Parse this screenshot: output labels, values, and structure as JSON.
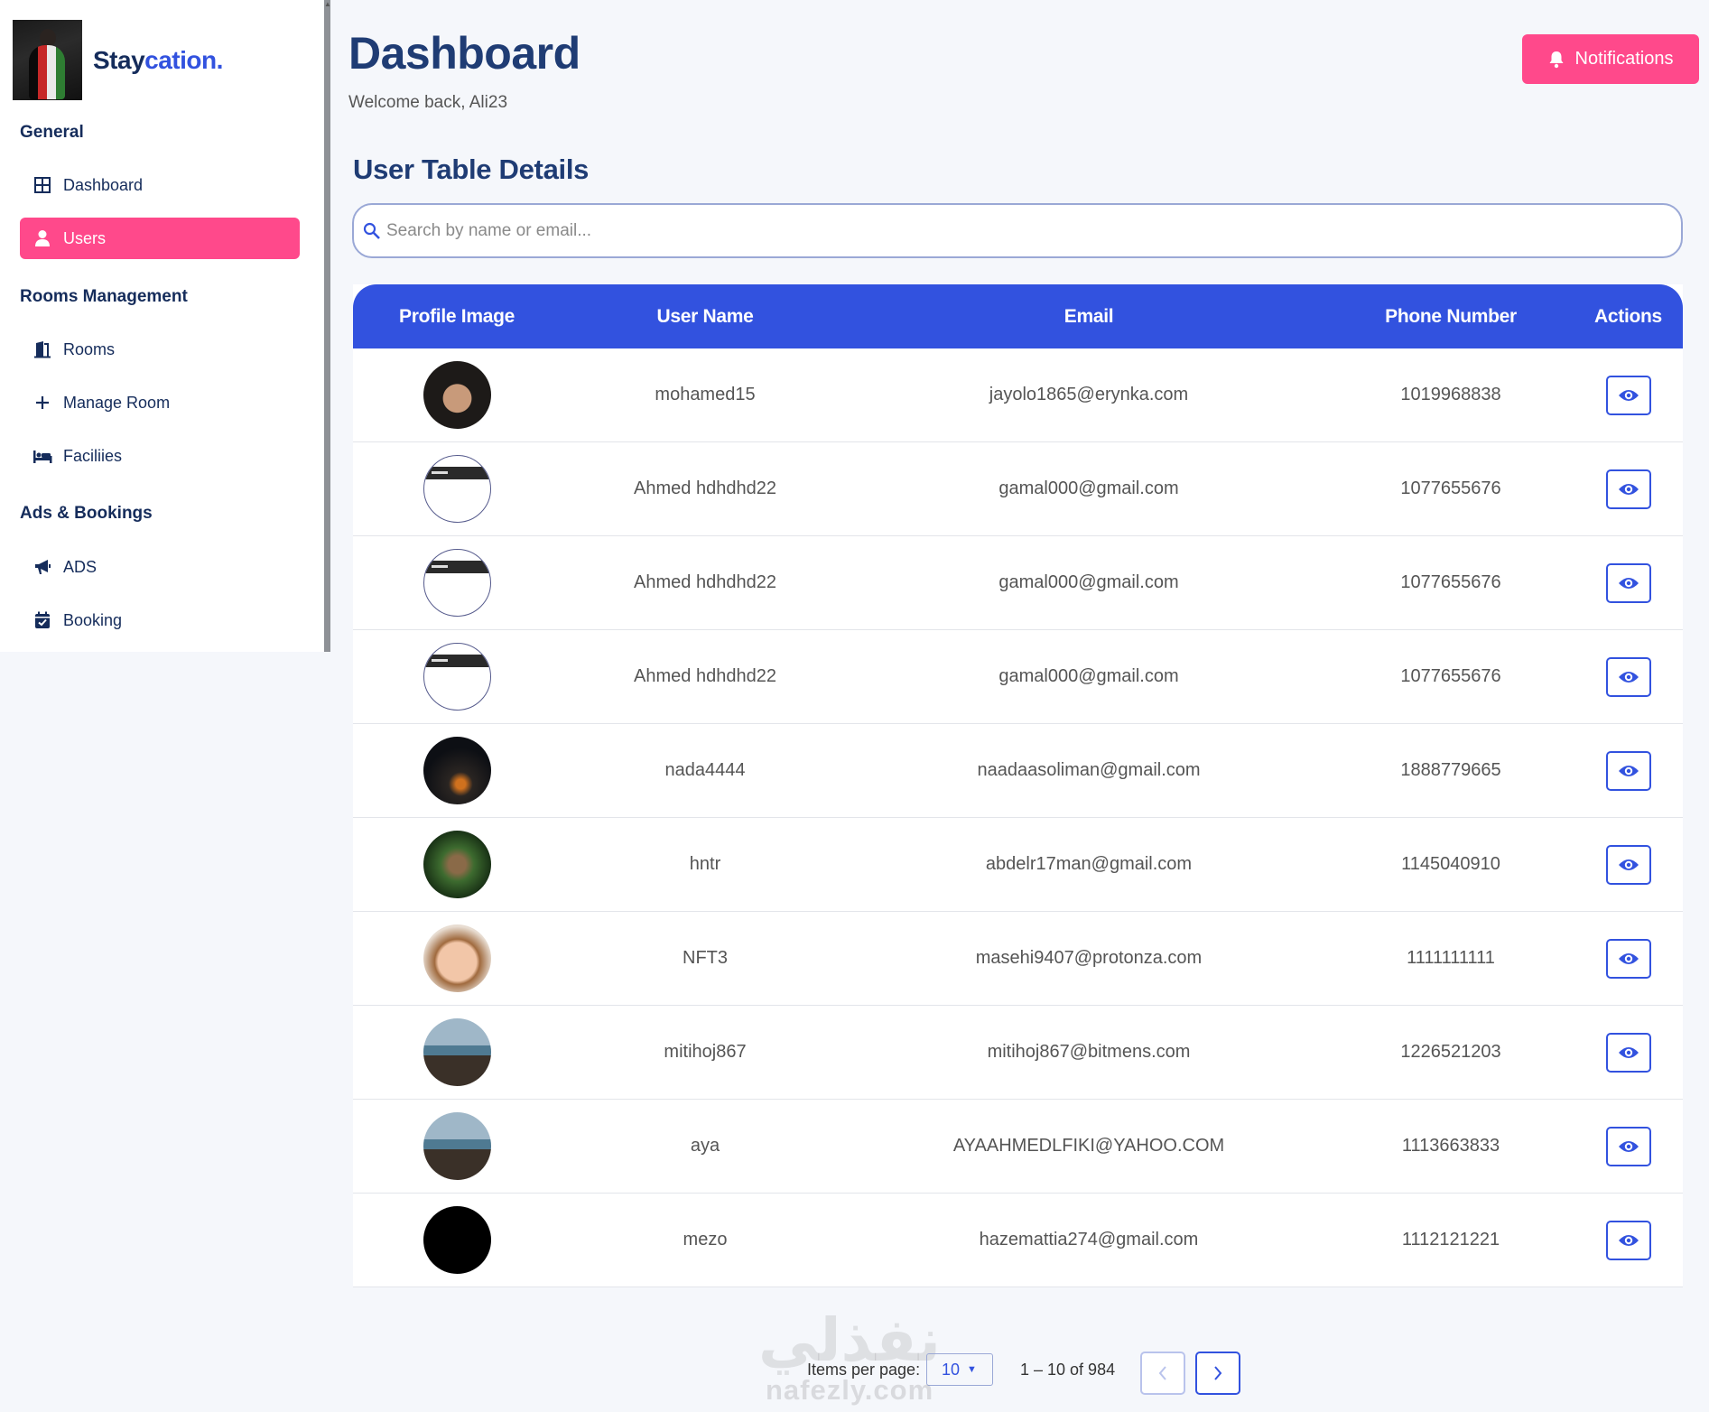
{
  "brand": {
    "name_part1": "Stay",
    "name_part2": "cation."
  },
  "sidebar": {
    "sections": [
      {
        "title": "General"
      },
      {
        "title": "Rooms Management"
      },
      {
        "title": "Ads & Bookings"
      }
    ],
    "items": [
      {
        "label": "Dashboard",
        "icon": "dashboard-icon"
      },
      {
        "label": "Users",
        "icon": "user-icon",
        "active": true
      },
      {
        "label": "Rooms",
        "icon": "door-icon"
      },
      {
        "label": "Manage Room",
        "icon": "plus-icon"
      },
      {
        "label": "Faciliies",
        "icon": "bed-icon"
      },
      {
        "label": "ADS",
        "icon": "megaphone-icon"
      },
      {
        "label": "Booking",
        "icon": "calendar-check-icon"
      }
    ]
  },
  "header": {
    "title": "Dashboard",
    "welcome": "Welcome back, Ali23",
    "notifications_label": "Notifications"
  },
  "main": {
    "subtitle": "User Table Details",
    "search_placeholder": "Search by name or email..."
  },
  "table": {
    "columns": [
      "Profile Image",
      "User Name",
      "Email",
      "Phone Number",
      "Actions"
    ],
    "rows": [
      {
        "avatar": "face",
        "username": "mohamed15",
        "email": "jayolo1865@erynka.com",
        "phone": "1019968838"
      },
      {
        "avatar": "screen",
        "username": "Ahmed hdhdhd22",
        "email": "gamal000@gmail.com",
        "phone": "1077655676"
      },
      {
        "avatar": "screen",
        "username": "Ahmed hdhdhd22",
        "email": "gamal000@gmail.com",
        "phone": "1077655676"
      },
      {
        "avatar": "screen",
        "username": "Ahmed hdhdhd22",
        "email": "gamal000@gmail.com",
        "phone": "1077655676"
      },
      {
        "avatar": "space",
        "username": "nada4444",
        "email": "naadaasoliman@gmail.com",
        "phone": "1888779665"
      },
      {
        "avatar": "art",
        "username": "hntr",
        "email": "abdelr17man@gmail.com",
        "phone": "1145040910"
      },
      {
        "avatar": "baby",
        "username": "NFT3",
        "email": "masehi9407@protonza.com",
        "phone": "1111111111"
      },
      {
        "avatar": "beach",
        "username": "mitihoj867",
        "email": "mitihoj867@bitmens.com",
        "phone": "1226521203"
      },
      {
        "avatar": "beach",
        "username": "aya",
        "email": "AYAAHMEDLFIKI@YAHOO.COM",
        "phone": "1113663833"
      },
      {
        "avatar": "black",
        "username": "mezo",
        "email": "hazemattia274@gmail.com",
        "phone": "1112121221"
      }
    ]
  },
  "pagination": {
    "items_per_page_label": "Items per page:",
    "items_per_page_value": "10",
    "range_text": "1 – 10 of 984"
  },
  "watermark": {
    "arabic": "نفذلي",
    "latin": "nafezly.com"
  },
  "colors": {
    "accent": "#3252df",
    "brand_pink": "#ff498b",
    "navy": "#152c5b"
  }
}
